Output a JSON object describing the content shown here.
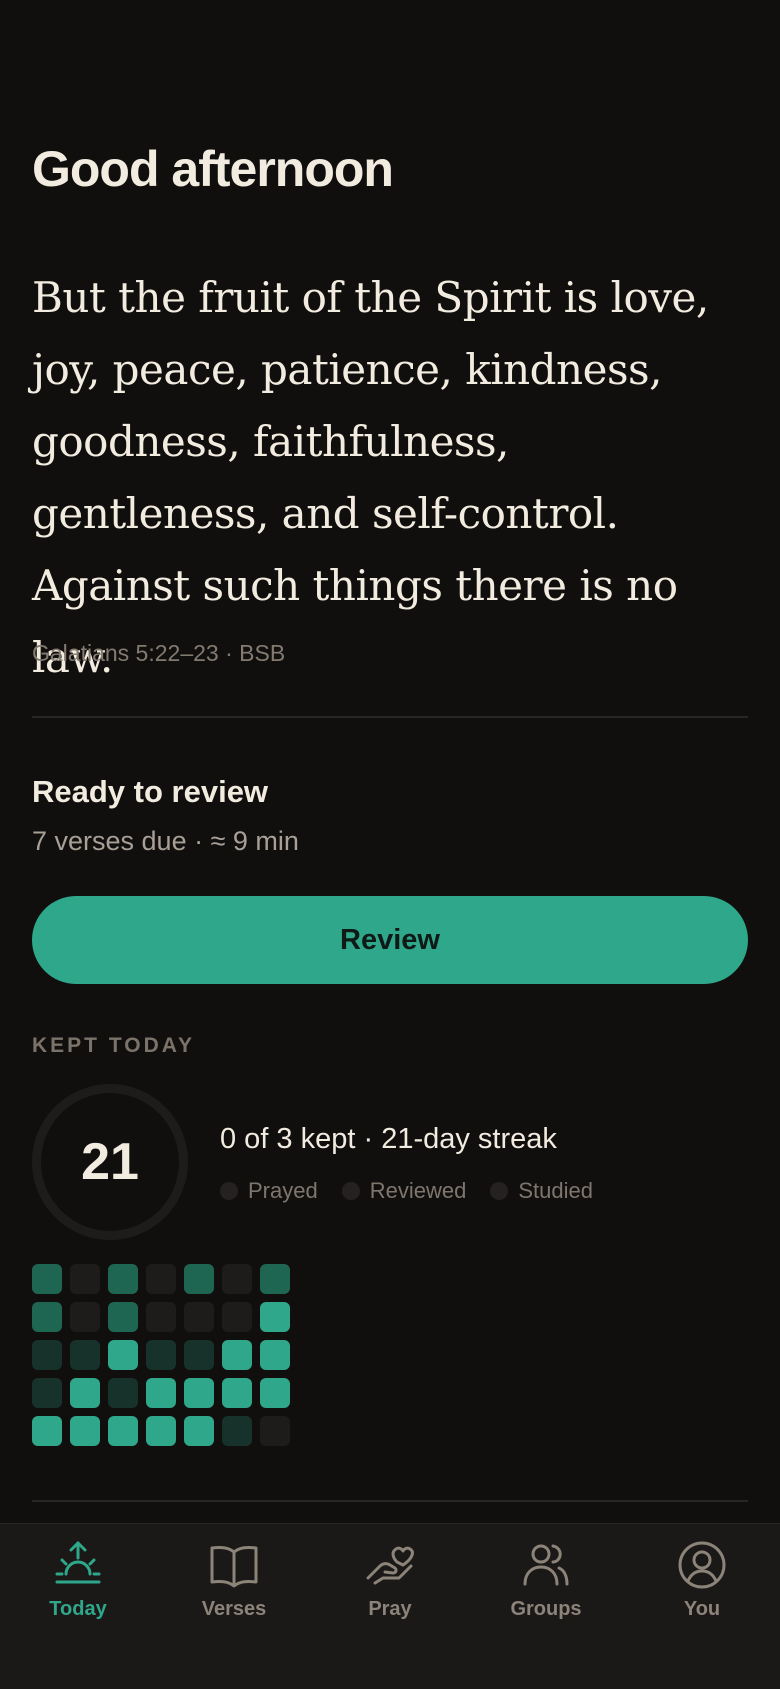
{
  "greeting": "Good afternoon",
  "verse": {
    "text": "But the fruit of the Spirit is love, joy, peace, patience, kindness, goodness, faithfulness, gentleness, and self-control. Against such things there is no law.",
    "reference": "Galatians 5:22–23 · BSB"
  },
  "review": {
    "title": "Ready to review",
    "subtitle": "7 verses due · ≈ 9 min",
    "button_label": "Review"
  },
  "kept_today": {
    "section_label": "KEPT TODAY",
    "streak_days": "21",
    "summary": "0 of 3 kept · 21-day streak",
    "habits": [
      {
        "label": "Prayed",
        "done": false
      },
      {
        "label": "Reviewed",
        "done": false
      },
      {
        "label": "Studied",
        "done": false
      }
    ],
    "heatmap_levels": [
      [
        2,
        0,
        2,
        0,
        2,
        0,
        2
      ],
      [
        2,
        0,
        2,
        0,
        0,
        0,
        3
      ],
      [
        1,
        1,
        3,
        1,
        1,
        3,
        3
      ],
      [
        1,
        3,
        1,
        3,
        3,
        3,
        3
      ],
      [
        3,
        3,
        3,
        3,
        3,
        1,
        0
      ]
    ]
  },
  "tabs": [
    {
      "label": "Today",
      "icon": "sunrise-icon",
      "active": true
    },
    {
      "label": "Verses",
      "icon": "open-book-icon",
      "active": false
    },
    {
      "label": "Pray",
      "icon": "hand-heart-icon",
      "active": false
    },
    {
      "label": "Groups",
      "icon": "users-icon",
      "active": false
    },
    {
      "label": "You",
      "icon": "user-circle-icon",
      "active": false
    }
  ],
  "colors": {
    "background": "#110f0e",
    "accent": "#2ea78b",
    "text_primary": "#f2ebdf",
    "text_muted": "#837a70",
    "tab_bar": "#1b1918",
    "heat_level_0": "#1e1c1a",
    "heat_level_1": "#17322b",
    "heat_level_2": "#1f6652",
    "heat_level_3": "#2ea78b"
  }
}
